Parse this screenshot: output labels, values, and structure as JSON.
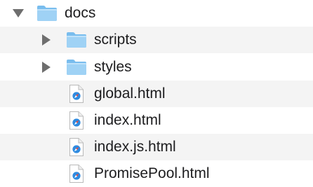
{
  "tree": {
    "items": [
      {
        "label": "docs",
        "type": "folder",
        "expanded": true
      },
      {
        "label": "scripts",
        "type": "folder",
        "expanded": false
      },
      {
        "label": "styles",
        "type": "folder",
        "expanded": false
      },
      {
        "label": "global.html",
        "type": "file",
        "icon": "safari-html-file-icon"
      },
      {
        "label": "index.html",
        "type": "file",
        "icon": "safari-html-file-icon"
      },
      {
        "label": "index.js.html",
        "type": "file",
        "icon": "safari-html-file-icon"
      },
      {
        "label": "PromisePool.html",
        "type": "file",
        "icon": "safari-html-file-icon"
      }
    ]
  },
  "colors": {
    "folder_body": "#8ec9f2",
    "folder_tab": "#6fb7ea",
    "alt_row": "#f4f4f4",
    "disclosure": "#6e6e6e",
    "compass_blue": "#2f8be0"
  }
}
